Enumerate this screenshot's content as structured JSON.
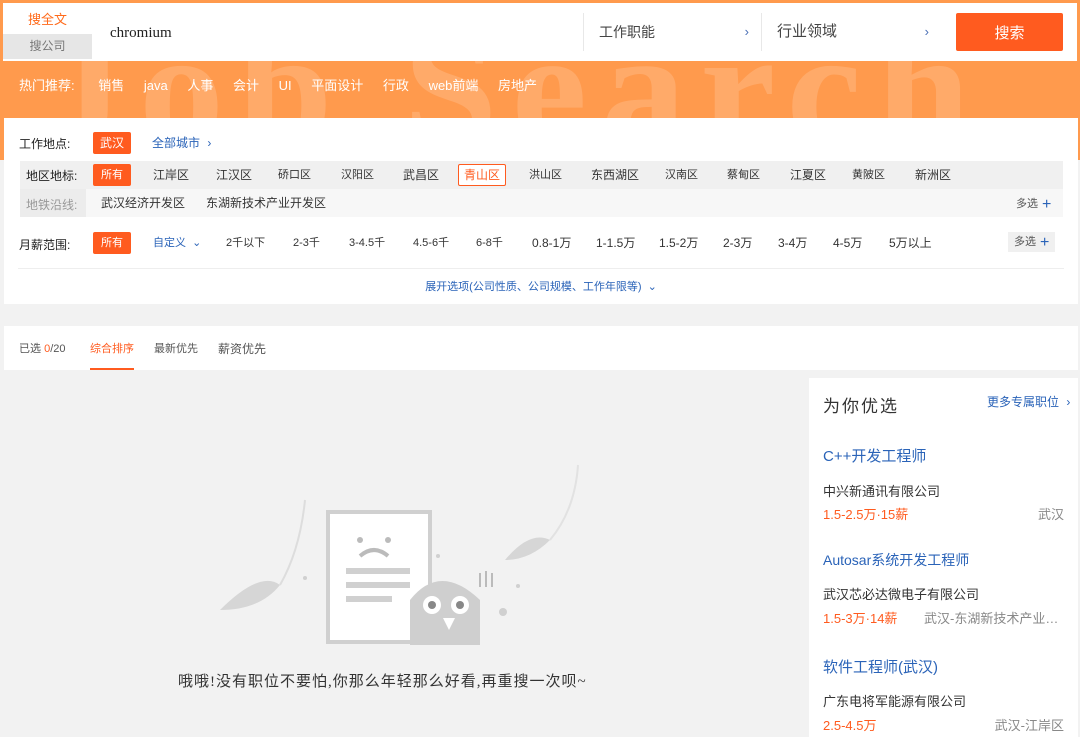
{
  "header": {
    "watermark": "Job Search",
    "modes": [
      "搜全文",
      "搜公司"
    ],
    "search_value": "chromium",
    "function_select": "工作职能",
    "industry_select": "行业领域",
    "search_button": "搜索",
    "hot_label": "热门推荐:",
    "hot_items": [
      "销售",
      "java",
      "人事",
      "会计",
      "UI",
      "平面设计",
      "行政",
      "web前端",
      "房地产"
    ]
  },
  "filters": {
    "location_label": "工作地点:",
    "location_active": "武汉",
    "all_cities": "全部城市",
    "district_label": "地区地标:",
    "district_all": "所有",
    "districts": [
      "江岸区",
      "江汉区",
      "硚口区",
      "汉阳区",
      "武昌区",
      "青山区",
      "洪山区",
      "东西湖区",
      "汉南区",
      "蔡甸区",
      "江夏区",
      "黄陂区",
      "新洲区"
    ],
    "subway_label": "地铁沿线:",
    "subway_items": [
      "武汉经济开发区",
      "东湖新技术产业开发区"
    ],
    "multi": "多选",
    "salary_label": "月薪范围:",
    "salary_all": "所有",
    "salary_custom": "自定义",
    "salary_items": [
      "2千以下",
      "2-3千",
      "3-4.5千",
      "4.5-6千",
      "6-8千",
      "0.8-1万",
      "1-1.5万",
      "1.5-2万",
      "2-3万",
      "3-4万",
      "4-5万",
      "5万以上"
    ],
    "expand_link": "展开选项(公司性质、公司规模、工作年限等)"
  },
  "sort": {
    "selected_prefix": "已选",
    "selected_count": "0",
    "selected_total": "/20",
    "items": [
      "综合排序",
      "最新优先",
      "薪资优先"
    ]
  },
  "empty": {
    "message": "哦哦!没有职位不要怕,你那么年轻那么好看,再重搜一次呗~"
  },
  "sidebar": {
    "title": "为你优选",
    "more": "更多专属职位",
    "jobs": [
      {
        "title": "C++开发工程师",
        "company": "中兴新通讯有限公司",
        "salary": "1.5-2.5万·15薪",
        "location": "武汉"
      },
      {
        "title": "Autosar系统开发工程师",
        "company": "武汉芯必达微电子有限公司",
        "salary": "1.5-3万·14薪",
        "location": "武汉-东湖新技术产业开发区"
      },
      {
        "title": "软件工程师(武汉)",
        "company": "广东电将军能源有限公司",
        "salary": "2.5-4.5万",
        "location": "武汉-江岸区"
      }
    ]
  },
  "colors": {
    "accent": "#ff5b1f",
    "header": "#ff9a4d",
    "link": "#2a63b8"
  }
}
